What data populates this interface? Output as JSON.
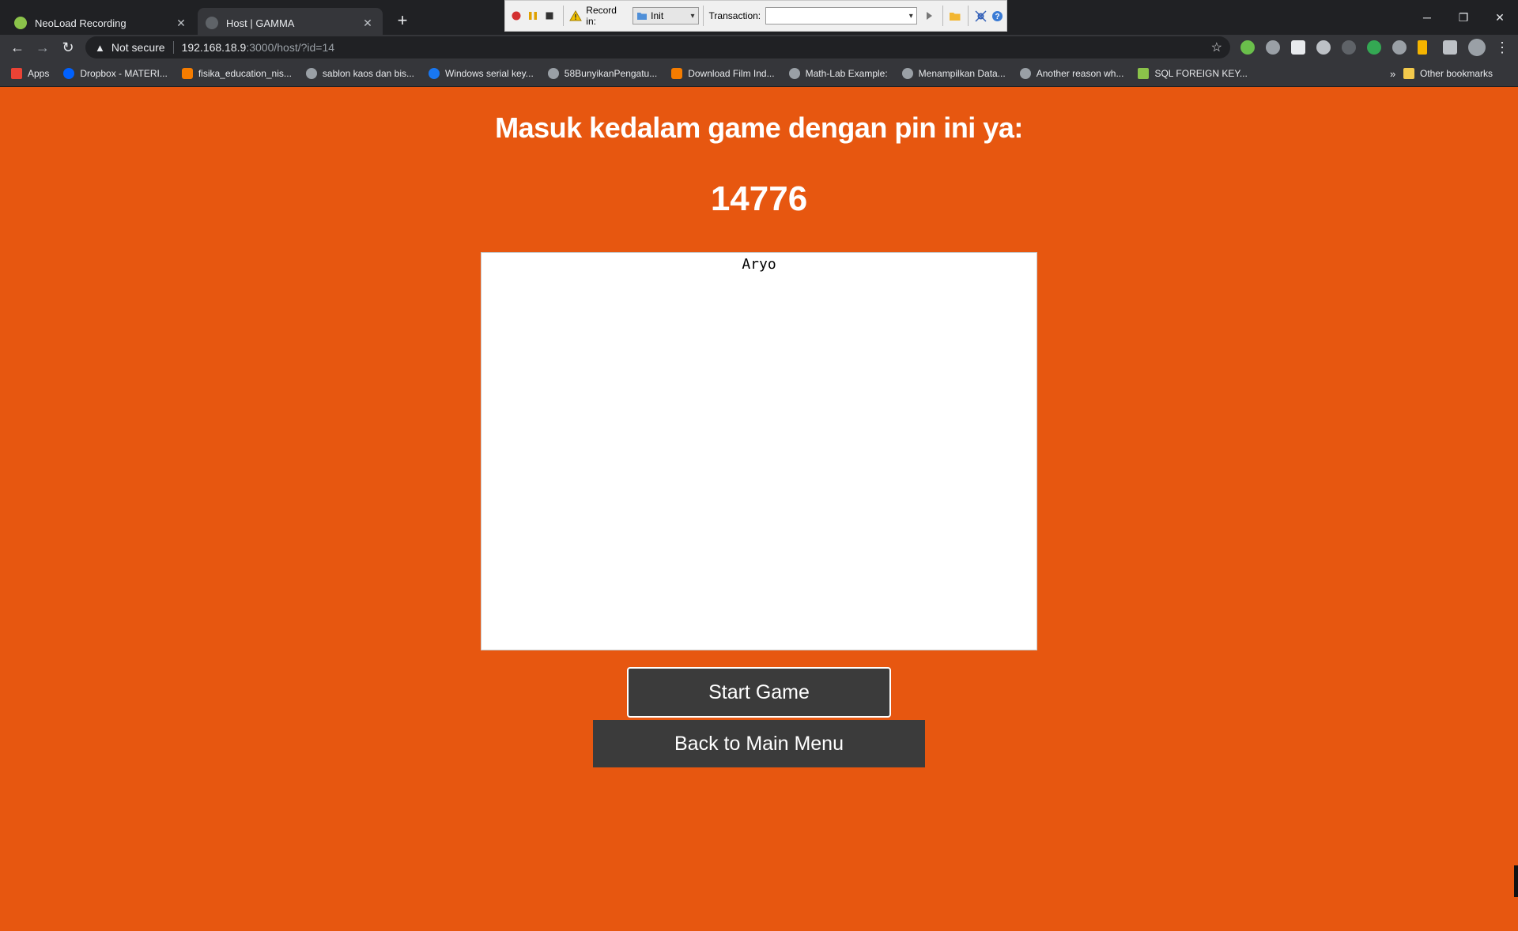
{
  "browser": {
    "tabs": [
      {
        "title": "NeoLoad Recording",
        "favicon_color": "#8bc34a"
      },
      {
        "title": "Host | GAMMA",
        "favicon_color": "#5f6368"
      }
    ],
    "new_tab_glyph": "+",
    "close_glyph": "✕",
    "window_controls": {
      "minimize": "─",
      "restore": "❐",
      "close": "✕"
    },
    "address": {
      "security_label": "Not secure",
      "host": "192.168.18.9",
      "path": ":3000/host/?id=14"
    },
    "bookmarks": [
      {
        "label": "Apps",
        "icon_color": "#ea4335"
      },
      {
        "label": "Dropbox - MATERI...",
        "icon_color": "#0061fe"
      },
      {
        "label": "fisika_education_nis...",
        "icon_color": "#f57c00"
      },
      {
        "label": "sablon kaos dan bis...",
        "icon_color": "#9aa0a6"
      },
      {
        "label": "Windows serial key...",
        "icon_color": "#1877f2"
      },
      {
        "label": "58BunyikanPengatu...",
        "icon_color": "#9aa0a6"
      },
      {
        "label": "Download Film Ind...",
        "icon_color": "#f57c00"
      },
      {
        "label": "Math-Lab Example:",
        "icon_color": "#9aa0a6"
      },
      {
        "label": "Menampilkan Data...",
        "icon_color": "#9aa0a6"
      },
      {
        "label": "Another reason wh...",
        "icon_color": "#9aa0a6"
      },
      {
        "label": "SQL FOREIGN KEY...",
        "icon_color": "#8bc34a"
      }
    ],
    "bookmarks_overflow": "»",
    "other_bookmarks": "Other bookmarks"
  },
  "neoload": {
    "record_in_label": "Record in:",
    "record_in_value": "Init",
    "transaction_label": "Transaction:",
    "transaction_value": ""
  },
  "page": {
    "heading": "Masuk kedalam game dengan pin ini ya:",
    "pin": "14776",
    "players": [
      "Aryo"
    ],
    "start_button": "Start Game",
    "back_button": "Back to Main Menu",
    "background_color": "#e75710",
    "button_color": "#3b3b3b"
  }
}
